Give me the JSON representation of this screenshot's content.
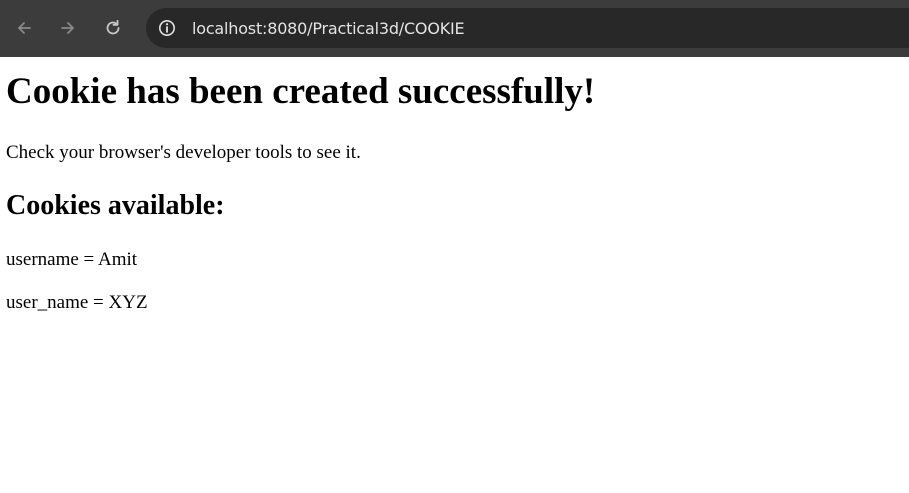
{
  "browser": {
    "url": "localhost:8080/Practical3d/COOKIE",
    "icons": {
      "back": "arrow-left-icon",
      "forward": "arrow-right-icon",
      "reload": "reload-icon",
      "site_info": "info-circle-icon"
    },
    "colors": {
      "toolbar": "#3c3c3c",
      "omnibox": "#282828",
      "icon": "#8a8a8a",
      "url_text": "#e3e3e3"
    }
  },
  "page": {
    "heading": "Cookie has been created successfully!",
    "message": "Check your browser's developer tools to see it.",
    "subheading": "Cookies available:",
    "cookies": [
      {
        "text": "username = Amit"
      },
      {
        "text": "user_name = XYZ"
      }
    ]
  }
}
